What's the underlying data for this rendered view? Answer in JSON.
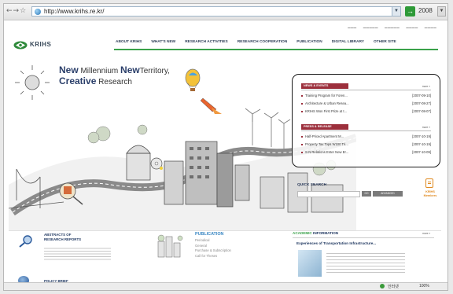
{
  "browser": {
    "nav_buttons": "←→☆",
    "url": "http://www.krihs.re.kr/",
    "year": "2008",
    "status_text": "인터넷",
    "status_zoom": "100%"
  },
  "header": {
    "logo": "KRIHS",
    "nav": [
      "ABOUT KRIHS",
      "WHAT'S NEW",
      "RESEARCH ACTIVITIES",
      "RESEARCH COOPERATION",
      "PUBLICATION",
      "DIGITAL LIBRARY",
      "OTHER SITE"
    ]
  },
  "hero": {
    "line1_a": "New",
    "line1_b": "Millennium",
    "line1_c": "New",
    "line1_d": "Territory,",
    "line2_a": "Creative",
    "line2_b": "Research"
  },
  "news": {
    "section1": "NEWS & EVENTS",
    "more": "more »",
    "items1": [
      {
        "title": "Training Program for Foren...",
        "date": "[2007-09-10]"
      },
      {
        "title": "Architecture & Urban Resea...",
        "date": "[2007-08-27]"
      },
      {
        "title": "KRIHS Won First Prize at t...",
        "date": "[2007-08-07]"
      }
    ],
    "section2": "PRESS & RELEASE",
    "items2": [
      {
        "title": "Half-Priced Apartment M...",
        "date": "[2007-10-19]"
      },
      {
        "title": "Property Tax Tops W100 Tri...",
        "date": "[2007-10-19]"
      },
      {
        "title": "S-N Relations Enter New Er...",
        "date": "[2007-10-09]"
      }
    ]
  },
  "quick_search": {
    "label": "QUICK SEARCH",
    "go": "GO",
    "advanced": "ADVANCED"
  },
  "kric": {
    "line1": "KRIHS",
    "line2": "Members"
  },
  "abstracts": {
    "line1": "ABSTRACTS OF",
    "line2": "RESEARCH REPORTS"
  },
  "policy": {
    "title": "POLICY BRIEF"
  },
  "publication": {
    "title": "PUBLICATION",
    "items": [
      "Periodical",
      "General",
      "Purchase & Subscription",
      "Call for Theses"
    ]
  },
  "academic": {
    "title_a": "ACADEMIC",
    "title_b": "INFORMATION",
    "more": "more »",
    "headline": "Experiences of Transportation Infrastructure..."
  }
}
